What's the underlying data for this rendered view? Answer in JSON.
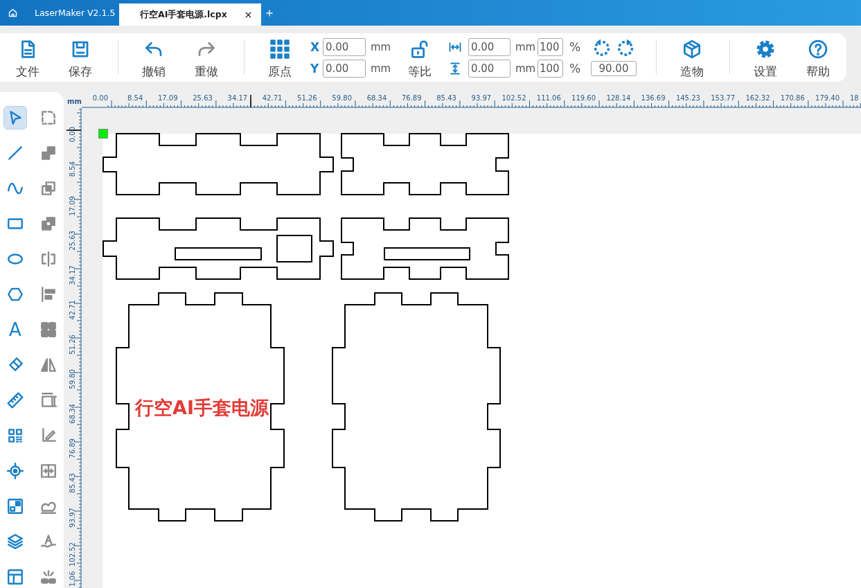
{
  "title_bar": {
    "app_title": "LaserMaker V2.1.5",
    "tabs": [
      {
        "label": "行空AI手套电源.lcpx",
        "selected": true
      }
    ]
  },
  "toolbar": [
    {
      "kind": "button",
      "label": "文件",
      "disabled": false
    },
    {
      "kind": "button",
      "label": "保存",
      "disabled": false
    },
    {
      "kind": "divider"
    },
    {
      "kind": "button",
      "label": "撤销",
      "disabled": false
    },
    {
      "kind": "button",
      "label": "重做",
      "disabled": true
    },
    {
      "kind": "divider"
    },
    {
      "kind": "button",
      "label": "原点",
      "disabled": false
    },
    {
      "kind": "position",
      "fields": [
        {
          "axis": "X",
          "value": "0.00",
          "unit": "mm"
        },
        {
          "axis": "Y",
          "value": "0.00",
          "unit": "mm"
        }
      ]
    },
    {
      "kind": "lock",
      "label": "等比",
      "locked": false
    },
    {
      "kind": "size",
      "fields": [
        {
          "value": "0.00",
          "unit": "mm",
          "percent": "100",
          "percent_unit": "%"
        },
        {
          "value": "0.00",
          "unit": "mm",
          "percent": "100",
          "percent_unit": "%"
        }
      ]
    },
    {
      "kind": "rotate",
      "angle": "90.00"
    },
    {
      "kind": "divider"
    },
    {
      "kind": "button",
      "label": "造物",
      "disabled": false
    },
    {
      "kind": "divider"
    },
    {
      "kind": "button",
      "label": "设置",
      "disabled": false
    },
    {
      "kind": "button",
      "label": "帮助",
      "disabled": false
    }
  ],
  "tools": [
    {
      "selected": true,
      "disabled": false
    },
    {
      "selected": false,
      "disabled": true
    },
    {
      "selected": false,
      "disabled": false
    },
    {
      "selected": false,
      "disabled": true
    },
    {
      "selected": false,
      "disabled": false
    },
    {
      "selected": false,
      "disabled": true
    },
    {
      "selected": false,
      "disabled": false
    },
    {
      "selected": false,
      "disabled": true
    },
    {
      "selected": false,
      "disabled": false
    },
    {
      "selected": false,
      "disabled": true
    },
    {
      "selected": false,
      "disabled": false
    },
    {
      "selected": false,
      "disabled": true
    },
    {
      "selected": false,
      "disabled": false,
      "glyph": "A"
    },
    {
      "selected": false,
      "disabled": true
    },
    {
      "selected": false,
      "disabled": false
    },
    {
      "selected": false,
      "disabled": true
    },
    {
      "selected": false,
      "disabled": false
    },
    {
      "selected": false,
      "disabled": true
    },
    {
      "selected": false,
      "disabled": false
    },
    {
      "selected": false,
      "disabled": true
    },
    {
      "selected": false,
      "disabled": false
    },
    {
      "selected": false,
      "disabled": true
    },
    {
      "selected": false,
      "disabled": false
    },
    {
      "selected": false,
      "disabled": true
    },
    {
      "selected": false,
      "disabled": false
    },
    {
      "selected": false,
      "disabled": true
    },
    {
      "selected": false,
      "disabled": false
    },
    {
      "selected": false,
      "disabled": true
    }
  ],
  "rulers": {
    "unit": "mm",
    "horizontal": [
      "0.00",
      "8.54",
      "17.09",
      "25.63",
      "34.17",
      "42.71",
      "51.26",
      "59.80",
      "68.34",
      "76.89",
      "85.43",
      "93.97",
      "102.52",
      "111.06",
      "119.60",
      "128.14",
      "136.69",
      "145.23",
      "153.77",
      "162.32",
      "170.86",
      "179.40",
      "18"
    ],
    "vertical": [
      "0.00",
      "8.54",
      "17.09",
      "25.63",
      "34.17",
      "42.71",
      "51.26",
      "59.80",
      "68.34",
      "76.89",
      "85.43",
      "93.97",
      "102.52",
      "1.06"
    ]
  },
  "canvas": {
    "text": "行空AI手套电源"
  }
}
